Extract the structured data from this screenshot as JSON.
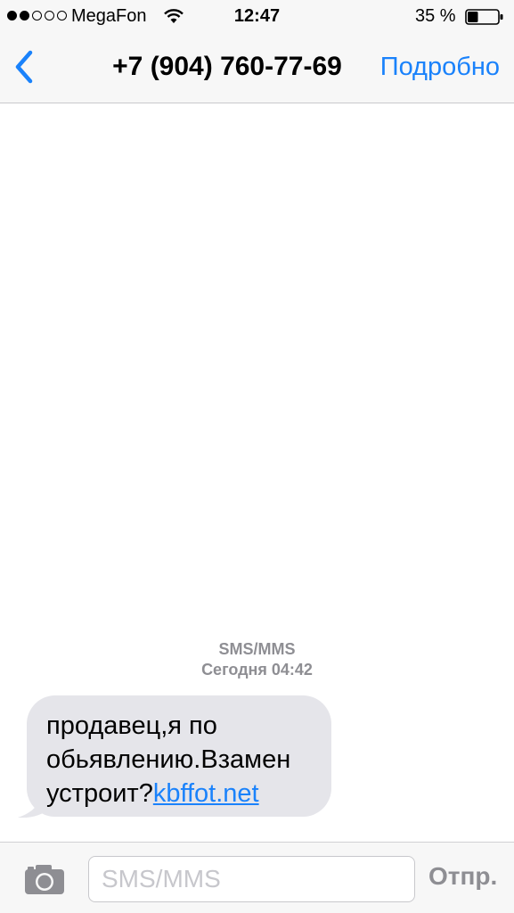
{
  "status_bar": {
    "carrier": "MegaFon",
    "time": "12:47",
    "battery_percent": "35 %",
    "signal_filled": 2,
    "signal_total": 5,
    "battery_level": 0.35
  },
  "nav": {
    "back_icon": "chevron-left-icon",
    "title": "+7 (904) 760-77-69",
    "details_label": "Подробно"
  },
  "conversation": {
    "service_label": "SMS/MMS",
    "timestamp": "Сегодня 04:42",
    "messages": [
      {
        "direction": "incoming",
        "lines": [
          "продавец,я по",
          "обьявлению.Взамен",
          "устроит?"
        ],
        "link_text": "kbffot.net"
      }
    ]
  },
  "input_bar": {
    "camera_icon": "camera-icon",
    "placeholder": "SMS/MMS",
    "value": "",
    "send_label": "Отпр."
  },
  "colors": {
    "accent": "#1a82fb",
    "bubble_incoming": "#e5e5ea",
    "bar_background": "#f7f7f7",
    "muted_text": "#8e8e93"
  }
}
